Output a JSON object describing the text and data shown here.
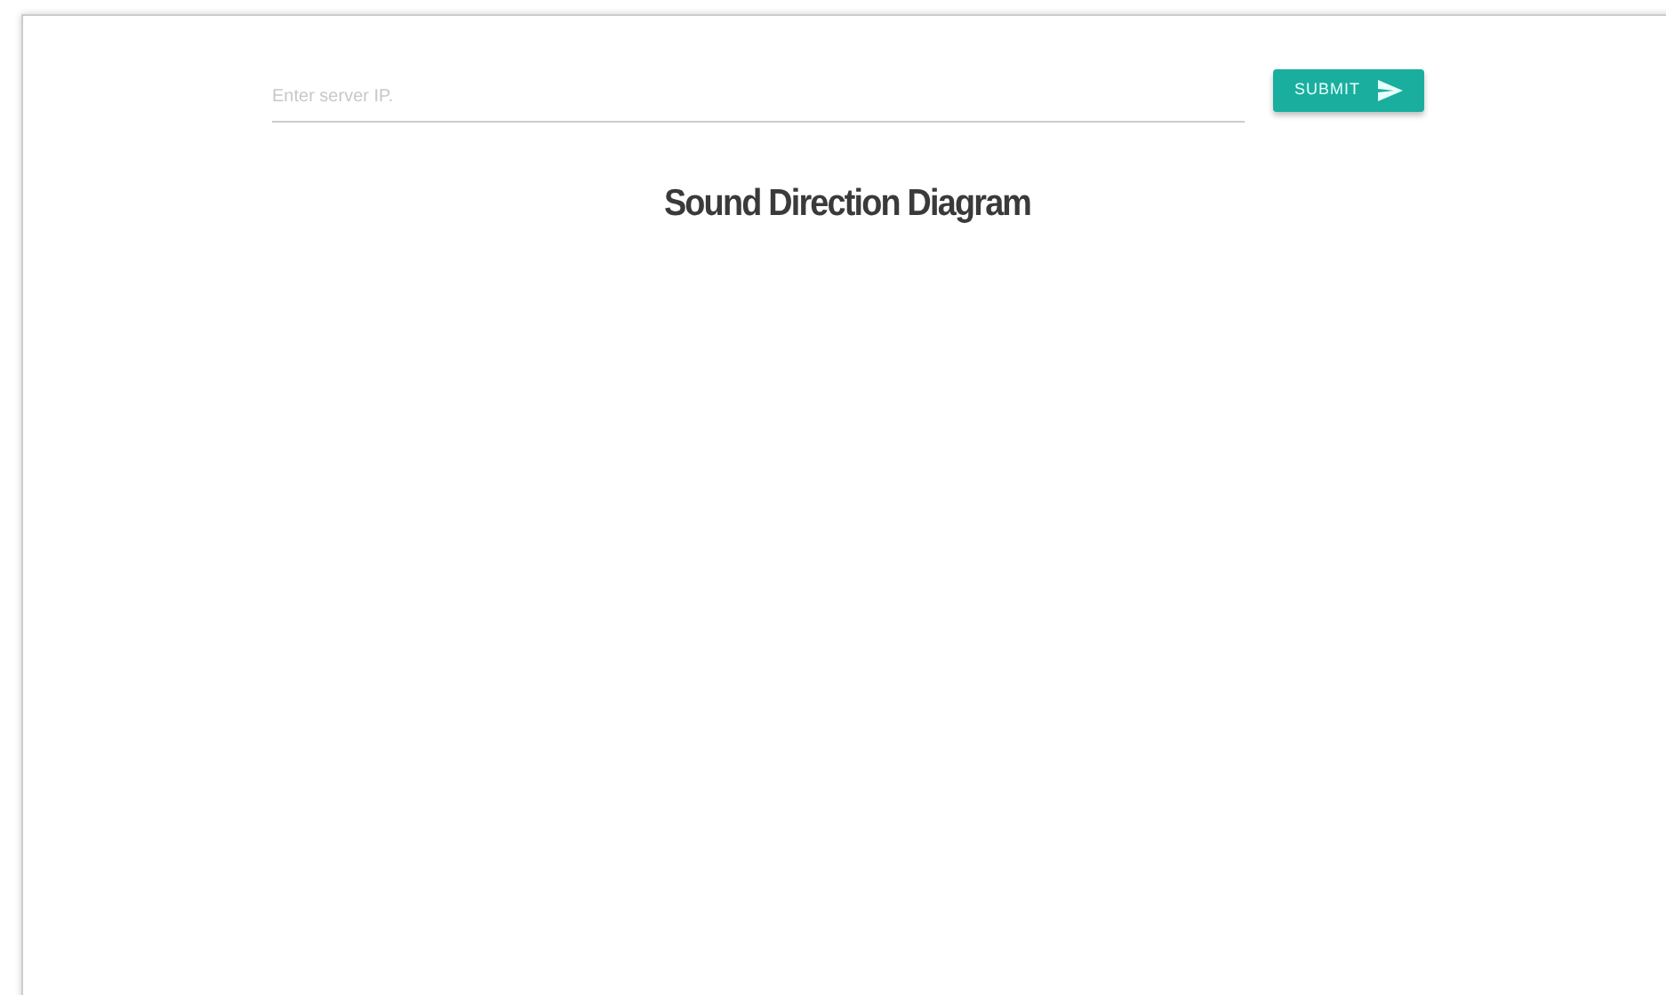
{
  "server_form": {
    "placeholder": "Enter server IP.",
    "button": "SUBMIT"
  },
  "title": "Sound Direction Diagram"
}
